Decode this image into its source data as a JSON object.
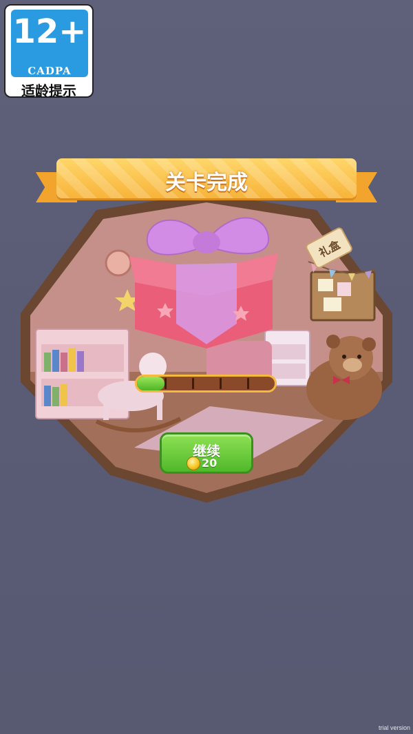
{
  "age_rating": {
    "age": "12+",
    "org": "CADPA",
    "caption": "适龄提示"
  },
  "level_complete": {
    "title": "关卡完成",
    "gift_tag": "礼盒",
    "progress": {
      "segments": 5,
      "filled": 1
    },
    "continue_button": {
      "label": "继续",
      "cost": "20",
      "cost_icon": "coin-icon"
    }
  },
  "watermark": "trial version",
  "colors": {
    "background": "#5f617a",
    "banner": "#f7b43a",
    "button": "#4fb82a",
    "age_badge": "#2a9be1"
  }
}
